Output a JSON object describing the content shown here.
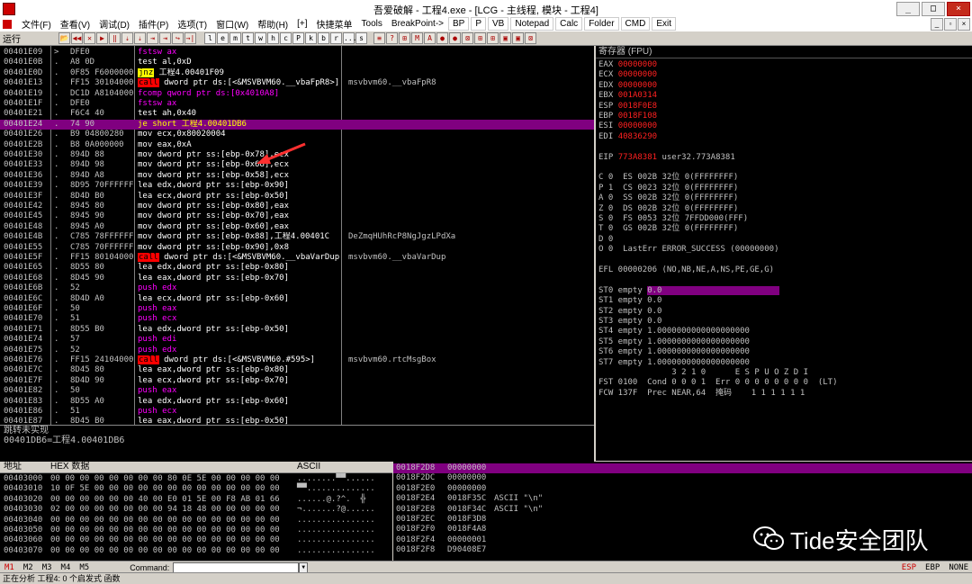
{
  "window": {
    "title": "吾爱破解 - 工程4.exe - [LCG - 主线程, 模块 - 工程4]",
    "btn_min": "_",
    "btn_max": "□",
    "btn_close": "×"
  },
  "menu": {
    "items": [
      "文件(F)",
      "查看(V)",
      "调试(D)",
      "插件(P)",
      "选项(T)",
      "窗口(W)",
      "帮助(H)",
      "[+]",
      "快捷菜单",
      "Tools",
      "BreakPoint->"
    ],
    "plugins": [
      "BP",
      "P",
      "VB",
      "Notepad",
      "Calc",
      "Folder",
      "CMD",
      "Exit"
    ],
    "sub_controls": [
      "_",
      "▫",
      "×"
    ]
  },
  "toolbar": {
    "status": "运行",
    "buttons_left": [
      "📂",
      "◀◀",
      "✕",
      "▶",
      "‖",
      "⇣",
      "⇣",
      "⇥",
      "⇥",
      "↪",
      "→|"
    ],
    "letters": [
      "l",
      "e",
      "m",
      "t",
      "w",
      "h",
      "c",
      "P",
      "k",
      "b",
      "r",
      "...",
      "s"
    ],
    "buttons_right": [
      "≡",
      "?",
      "⊞",
      "M",
      "A",
      "●",
      "●",
      "⊠",
      "⊞",
      "⊞",
      "▣",
      "▣",
      "⊠"
    ]
  },
  "disasm": {
    "rows": [
      {
        "addr": "00401E09",
        "mark": ">",
        "hex": "DFE0",
        "ins": "fstsw ax",
        "style": "fpu",
        "cmt": ""
      },
      {
        "addr": "00401E0B",
        "mark": ".",
        "hex": "A8 0D",
        "ins": "test al,0xD",
        "style": "",
        "cmt": ""
      },
      {
        "addr": "00401E0D",
        "mark": ".",
        "hex": "0F85 F6000000",
        "ins": "jnz 工程4.00401F09",
        "style": "jnz",
        "cmt": ""
      },
      {
        "addr": "00401E13",
        "mark": ".",
        "hex": "FF15 30104000",
        "ins": "call dword ptr ds:[<&MSVBVM60.__vbaFpR8>]",
        "style": "call",
        "cmt": "msvbvm60.__vbaFpR8"
      },
      {
        "addr": "00401E19",
        "mark": ".",
        "hex": "DC1D A8104000",
        "ins": "fcomp qword ptr ds:[0x4010A8]",
        "style": "fpu",
        "cmt": ""
      },
      {
        "addr": "00401E1F",
        "mark": ".",
        "hex": "DFE0",
        "ins": "fstsw ax",
        "style": "fpu",
        "cmt": ""
      },
      {
        "addr": "00401E21",
        "mark": ".",
        "hex": "F6C4 40",
        "ins": "test ah,0x40",
        "style": "",
        "cmt": ""
      },
      {
        "addr": "00401E24",
        "mark": ".",
        "hex": "74 90",
        "ins": "je short 工程4.00401DB6",
        "style": "je",
        "cmt": ""
      },
      {
        "addr": "00401E26",
        "mark": ".",
        "hex": "B9 04800280",
        "ins": "mov ecx,0x80020004",
        "style": "",
        "cmt": ""
      },
      {
        "addr": "00401E2B",
        "mark": ".",
        "hex": "B8 0A000000",
        "ins": "mov eax,0xA",
        "style": "",
        "cmt": ""
      },
      {
        "addr": "00401E30",
        "mark": ".",
        "hex": "894D 88",
        "ins": "mov dword ptr ss:[ebp-0x78],ecx",
        "style": "",
        "cmt": ""
      },
      {
        "addr": "00401E33",
        "mark": ".",
        "hex": "894D 98",
        "ins": "mov dword ptr ss:[ebp-0x68],ecx",
        "style": "",
        "cmt": ""
      },
      {
        "addr": "00401E36",
        "mark": ".",
        "hex": "894D A8",
        "ins": "mov dword ptr ss:[ebp-0x58],ecx",
        "style": "",
        "cmt": ""
      },
      {
        "addr": "00401E39",
        "mark": ".",
        "hex": "8D95 70FFFFFF",
        "ins": "lea edx,dword ptr ss:[ebp-0x90]",
        "style": "",
        "cmt": ""
      },
      {
        "addr": "00401E3F",
        "mark": ".",
        "hex": "8D4D B0",
        "ins": "lea ecx,dword ptr ss:[ebp-0x50]",
        "style": "",
        "cmt": ""
      },
      {
        "addr": "00401E42",
        "mark": ".",
        "hex": "8945 80",
        "ins": "mov dword ptr ss:[ebp-0x80],eax",
        "style": "",
        "cmt": ""
      },
      {
        "addr": "00401E45",
        "mark": ".",
        "hex": "8945 90",
        "ins": "mov dword ptr ss:[ebp-0x70],eax",
        "style": "",
        "cmt": ""
      },
      {
        "addr": "00401E48",
        "mark": ".",
        "hex": "8945 A0",
        "ins": "mov dword ptr ss:[ebp-0x60],eax",
        "style": "",
        "cmt": ""
      },
      {
        "addr": "00401E4B",
        "mark": ".",
        "hex": "C785 78FFFFFF",
        "ins": "mov dword ptr ss:[ebp-0x88],工程4.00401C",
        "style": "",
        "cmt": "DeZmqHUhRcP8NgJgzLPdXa"
      },
      {
        "addr": "00401E55",
        "mark": ".",
        "hex": "C785 70FFFFFF",
        "ins": "mov dword ptr ss:[ebp-0x90],0x8",
        "style": "",
        "cmt": ""
      },
      {
        "addr": "00401E5F",
        "mark": ".",
        "hex": "FF15 80104000",
        "ins": "call dword ptr ds:[<&MSVBVM60.__vbaVarDup>]",
        "style": "call",
        "cmt": "msvbvm60.__vbaVarDup"
      },
      {
        "addr": "00401E65",
        "mark": ".",
        "hex": "8D55 80",
        "ins": "lea edx,dword ptr ss:[ebp-0x80]",
        "style": "",
        "cmt": ""
      },
      {
        "addr": "00401E68",
        "mark": ".",
        "hex": "8D45 90",
        "ins": "lea eax,dword ptr ss:[ebp-0x70]",
        "style": "",
        "cmt": ""
      },
      {
        "addr": "00401E6B",
        "mark": ".",
        "hex": "52",
        "ins": "push edx",
        "style": "push",
        "cmt": ""
      },
      {
        "addr": "00401E6C",
        "mark": ".",
        "hex": "8D4D A0",
        "ins": "lea ecx,dword ptr ss:[ebp-0x60]",
        "style": "",
        "cmt": ""
      },
      {
        "addr": "00401E6F",
        "mark": ".",
        "hex": "50",
        "ins": "push eax",
        "style": "push",
        "cmt": ""
      },
      {
        "addr": "00401E70",
        "mark": ".",
        "hex": "51",
        "ins": "push ecx",
        "style": "push",
        "cmt": ""
      },
      {
        "addr": "00401E71",
        "mark": ".",
        "hex": "8D55 B0",
        "ins": "lea edx,dword ptr ss:[ebp-0x50]",
        "style": "",
        "cmt": ""
      },
      {
        "addr": "00401E74",
        "mark": ".",
        "hex": "57",
        "ins": "push edi",
        "style": "push",
        "cmt": ""
      },
      {
        "addr": "00401E75",
        "mark": ".",
        "hex": "52",
        "ins": "push edx",
        "style": "push",
        "cmt": ""
      },
      {
        "addr": "00401E76",
        "mark": ".",
        "hex": "FF15 24104000",
        "ins": "call dword ptr ds:[<&MSVBVM60.#595>]",
        "style": "call",
        "cmt": "msvbvm60.rtcMsgBox"
      },
      {
        "addr": "00401E7C",
        "mark": ".",
        "hex": "8D45 80",
        "ins": "lea eax,dword ptr ss:[ebp-0x80]",
        "style": "",
        "cmt": ""
      },
      {
        "addr": "00401E7F",
        "mark": ".",
        "hex": "8D4D 90",
        "ins": "lea ecx,dword ptr ss:[ebp-0x70]",
        "style": "",
        "cmt": ""
      },
      {
        "addr": "00401E82",
        "mark": ".",
        "hex": "50",
        "ins": "push eax",
        "style": "push",
        "cmt": ""
      },
      {
        "addr": "00401E83",
        "mark": ".",
        "hex": "8D55 A0",
        "ins": "lea edx,dword ptr ss:[ebp-0x60]",
        "style": "",
        "cmt": ""
      },
      {
        "addr": "00401E86",
        "mark": ".",
        "hex": "51",
        "ins": "push ecx",
        "style": "push",
        "cmt": ""
      },
      {
        "addr": "00401E87",
        "mark": ".",
        "hex": "8D45 B0",
        "ins": "lea eax,dword ptr ss:[ebp-0x50]",
        "style": "",
        "cmt": ""
      }
    ],
    "highlight_index": 7
  },
  "info": {
    "line1": "跳转未实现",
    "line2": "00401DB6=工程4.00401DB6"
  },
  "registers": {
    "header": "寄存器 (FPU)",
    "lines": [
      {
        "t": "EAX 00000000",
        "red": true
      },
      {
        "t": "ECX 00000000",
        "red": true
      },
      {
        "t": "EDX 00000000",
        "red": true
      },
      {
        "t": "EBX 001A0314",
        "red": true
      },
      {
        "t": "ESP 0018F0E8",
        "red": true
      },
      {
        "t": "EBP 0018F108",
        "red": true
      },
      {
        "t": "ESI 00000000",
        "red": true
      },
      {
        "t": "EDI 40836290",
        "red": true
      },
      {
        "t": "",
        "red": false
      },
      {
        "t": "EIP 773A8381 user32.773A8381",
        "red": false
      },
      {
        "t": "",
        "red": false
      },
      {
        "t": "C 0  ES 002B 32位 0(FFFFFFFF)",
        "red": false
      },
      {
        "t": "P 1  CS 0023 32位 0(FFFFFFFF)",
        "red": false
      },
      {
        "t": "A 0  SS 002B 32位 0(FFFFFFFF)",
        "red": false
      },
      {
        "t": "Z 0  DS 002B 32位 0(FFFFFFFF)",
        "red": false
      },
      {
        "t": "S 0  FS 0053 32位 7FFDD000(FFF)",
        "red": false
      },
      {
        "t": "T 0  GS 002B 32位 0(FFFFFFFF)",
        "red": false
      },
      {
        "t": "D 0",
        "red": false
      },
      {
        "t": "O 0  LastErr ERROR_SUCCESS (00000000)",
        "red": false
      },
      {
        "t": "",
        "red": false
      },
      {
        "t": "EFL 00000206 (NO,NB,NE,A,NS,PE,GE,G)",
        "red": false
      },
      {
        "t": "",
        "red": false
      },
      {
        "t": "ST0 empty 0.0",
        "red": false,
        "hl": true
      },
      {
        "t": "ST1 empty 0.0",
        "red": false
      },
      {
        "t": "ST2 empty 0.0",
        "red": false
      },
      {
        "t": "ST3 empty 0.0",
        "red": false
      },
      {
        "t": "ST4 empty 1.0000000000000000000",
        "red": false
      },
      {
        "t": "ST5 empty 1.0000000000000000000",
        "red": false
      },
      {
        "t": "ST6 empty 1.0000000000000000000",
        "red": false
      },
      {
        "t": "ST7 empty 1.0000000000000000000",
        "red": false
      },
      {
        "t": "               3 2 1 0      E S P U O Z D I",
        "red": false
      },
      {
        "t": "FST 0100  Cond 0 0 0 1  Err 0 0 0 0 0 0 0 0  (LT)",
        "red": false
      },
      {
        "t": "FCW 137F  Prec NEAR,64  掩码    1 1 1 1 1 1",
        "red": false
      }
    ]
  },
  "dump": {
    "headers": {
      "addr": "地址",
      "hex": "HEX 数据",
      "ascii": "ASCII"
    },
    "rows": [
      {
        "addr": "00403000",
        "hex": "00 00 00 00 00 00 00 00 80 0E 5E 00 00 00 00 00",
        "ascii": "........▀▀......"
      },
      {
        "addr": "00403010",
        "hex": "10 0F 5E 00 00 00 00 00 00 00 00 00 00 00 00 00",
        "ascii": "▀▀.............."
      },
      {
        "addr": "00403020",
        "hex": "00 00 00 00 00 00 40 00 E0 01 5E 00 F8 AB 01 66",
        "ascii": "......@.?^.  ╬"
      },
      {
        "addr": "00403030",
        "hex": "02 00 00 00 00 00 00 00 94 18 48 00 00 00 00 00",
        "ascii": "¬.......?@......"
      },
      {
        "addr": "00403040",
        "hex": "00 00 00 00 00 00 00 00 00 00 00 00 00 00 00 00",
        "ascii": "................"
      },
      {
        "addr": "00403050",
        "hex": "00 00 00 00 00 00 00 00 00 00 00 00 00 00 00 00",
        "ascii": "................"
      },
      {
        "addr": "00403060",
        "hex": "00 00 00 00 00 00 00 00 00 00 00 00 00 00 00 00",
        "ascii": "................"
      },
      {
        "addr": "00403070",
        "hex": "00 00 00 00 00 00 00 00 00 00 00 00 00 00 00 00",
        "ascii": "................"
      }
    ]
  },
  "stack": {
    "rows": [
      {
        "addr": "0018F2D8",
        "val": "00000000",
        "cmt": ""
      },
      {
        "addr": "0018F2DC",
        "val": "00000000",
        "cmt": ""
      },
      {
        "addr": "0018F2E0",
        "val": "00000000",
        "cmt": ""
      },
      {
        "addr": "0018F2E4",
        "val": "0018F35C",
        "cmt": "ASCII \"\\n\""
      },
      {
        "addr": "0018F2E8",
        "val": "0018F34C",
        "cmt": "ASCII \"\\n\""
      },
      {
        "addr": "0018F2EC",
        "val": "0018F3D8",
        "cmt": ""
      },
      {
        "addr": "0018F2F0",
        "val": "0018F4A8",
        "cmt": ""
      },
      {
        "addr": "0018F2F4",
        "val": "00000001",
        "cmt": ""
      },
      {
        "addr": "0018F2F8",
        "val": "D90408E7",
        "cmt": ""
      }
    ]
  },
  "watermark": {
    "text": "Tide安全团队"
  },
  "cmdbar": {
    "tabs": [
      "M1",
      "M2",
      "M3",
      "M4",
      "M5"
    ],
    "label": "Command:",
    "right": [
      "ESP",
      "EBP",
      "NONE"
    ]
  },
  "statusbar": {
    "text": "正在分析 工程4:  0 个启发式 函数"
  },
  "colors": {
    "accent_purple": "#800080",
    "call_red": "#ff0000",
    "jnz_yellow": "#ffff00",
    "reg_red": "#ff2020"
  }
}
